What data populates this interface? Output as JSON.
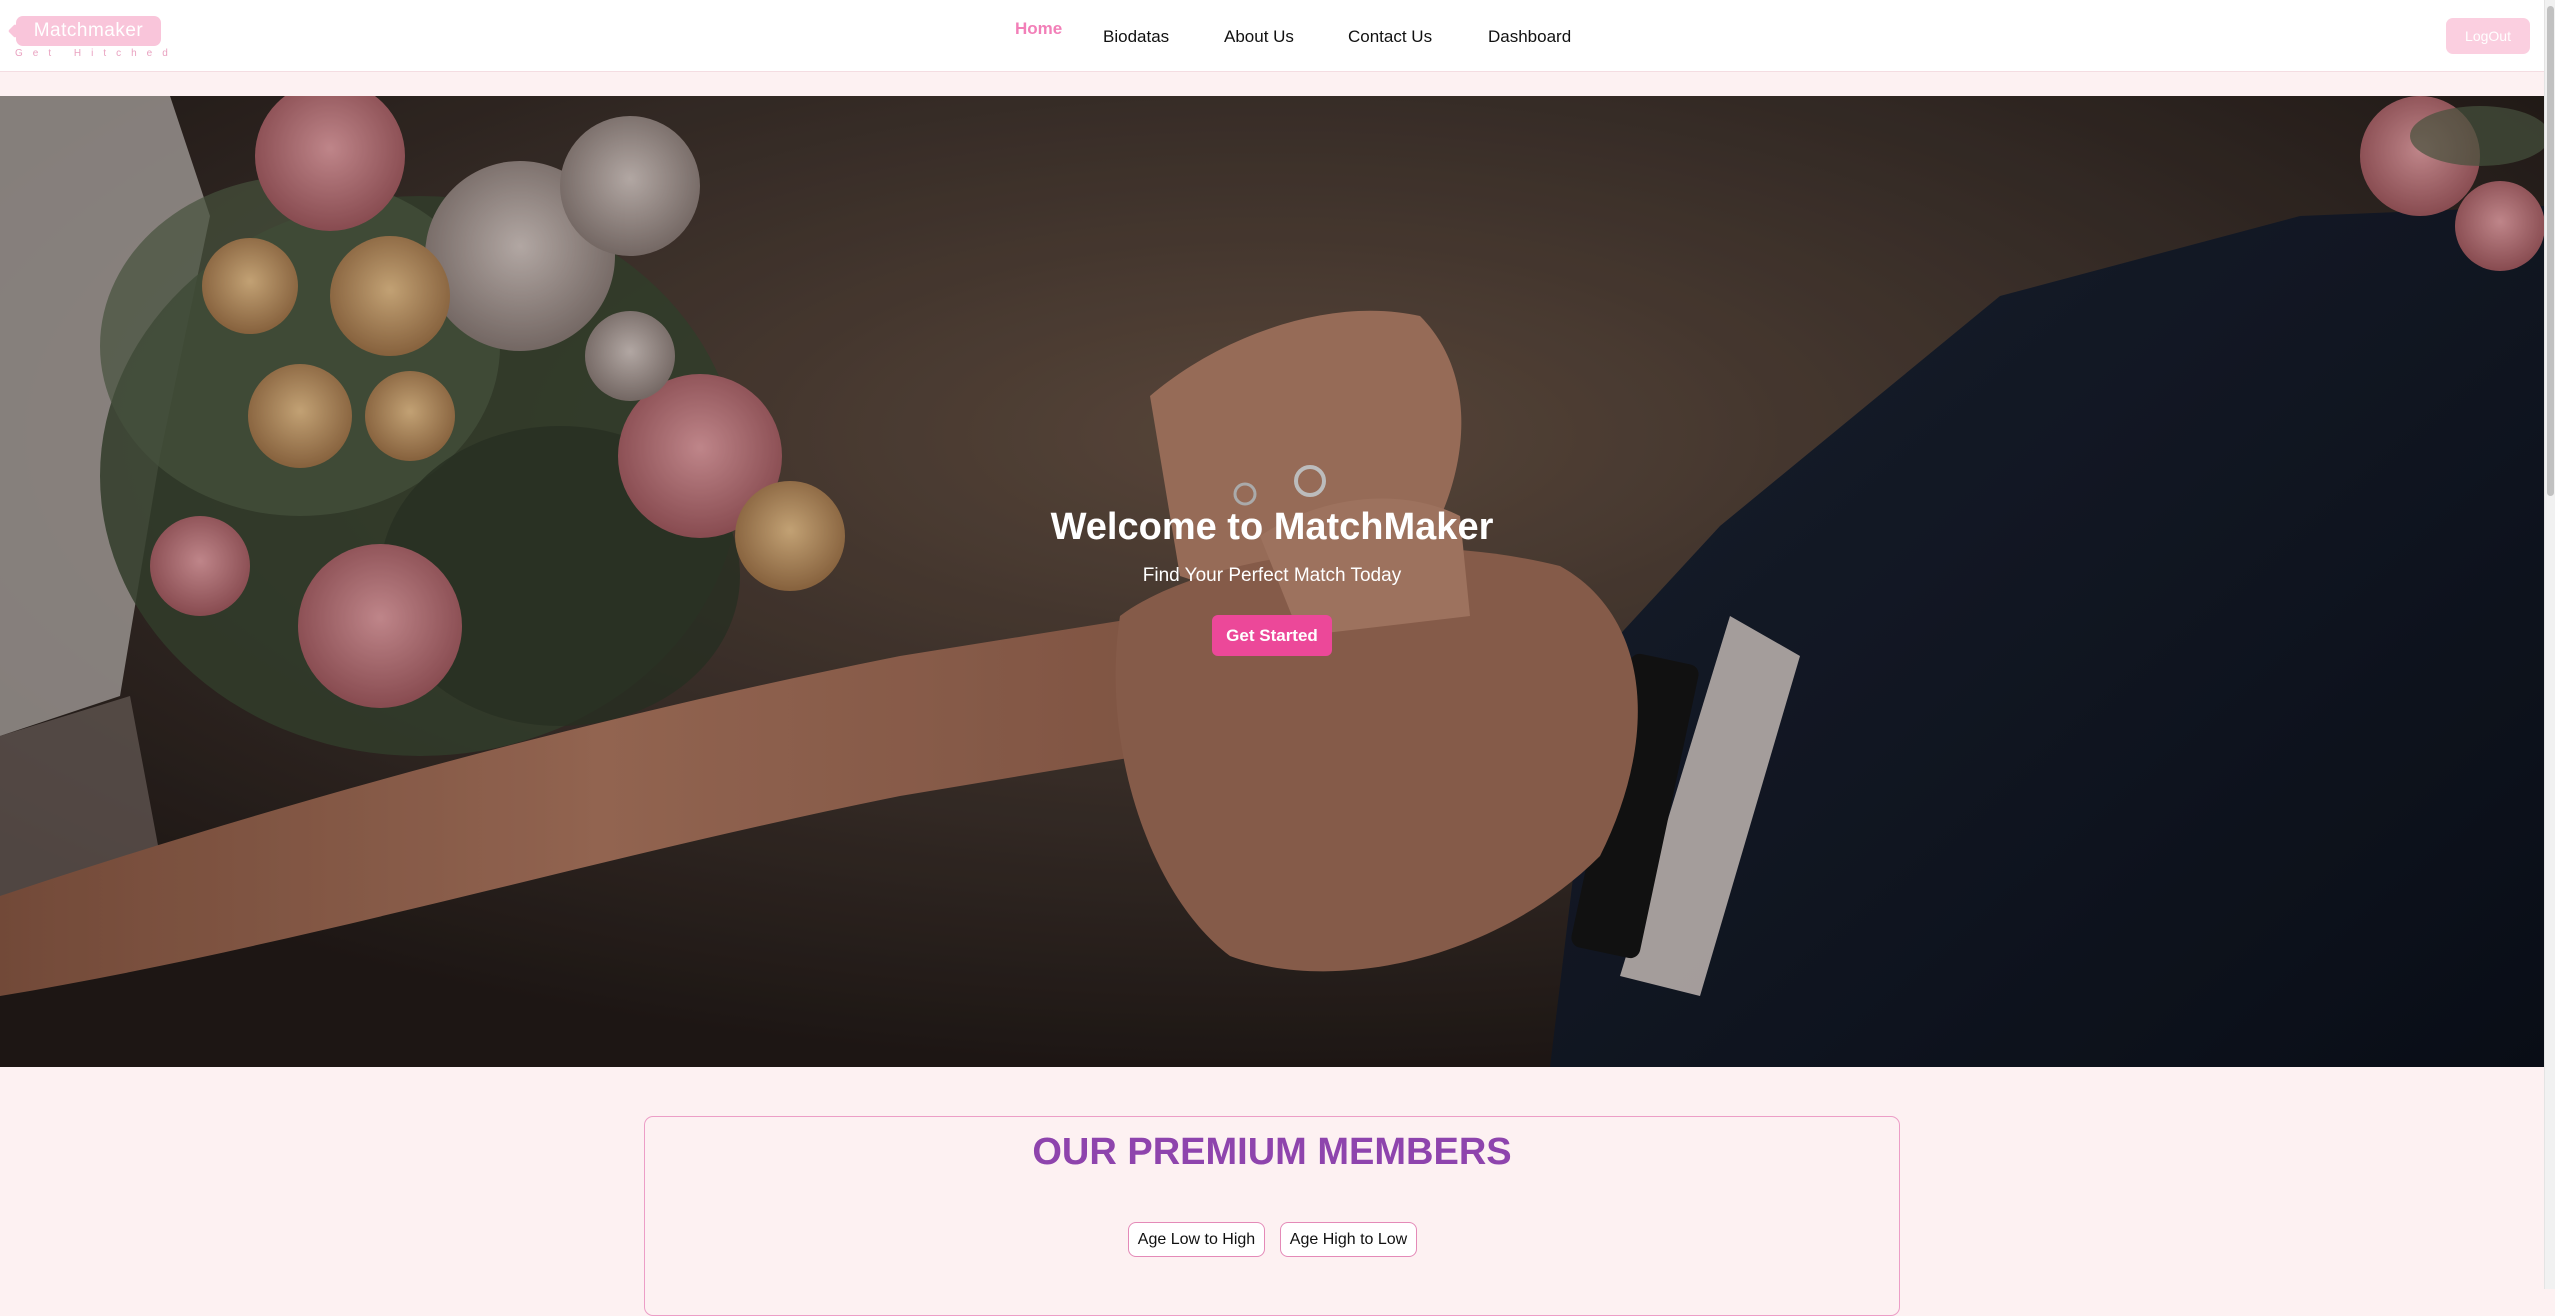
{
  "brand": {
    "name": "Matchmaker",
    "tagline": "Get Hitched",
    "accent_color": "#ec4899",
    "light_pink": "#f9c5da",
    "title_purple": "#8e44ad"
  },
  "nav": {
    "links": [
      {
        "label": "Home",
        "active": true
      },
      {
        "label": "Biodatas",
        "active": false
      },
      {
        "label": "About Us",
        "active": false
      },
      {
        "label": "Contact Us",
        "active": false
      },
      {
        "label": "Dashboard",
        "active": false
      }
    ],
    "logout_label": "LogOut"
  },
  "hero": {
    "title": "Welcome to MatchMaker",
    "subtitle": "Find Your Perfect Match Today",
    "cta_label": "Get Started",
    "image_description_icon": "wedding-hands-photo"
  },
  "premium": {
    "title": "OUR PREMIUM MEMBERS",
    "sort_options": [
      "Age Low to High",
      "Age High to Low"
    ]
  }
}
